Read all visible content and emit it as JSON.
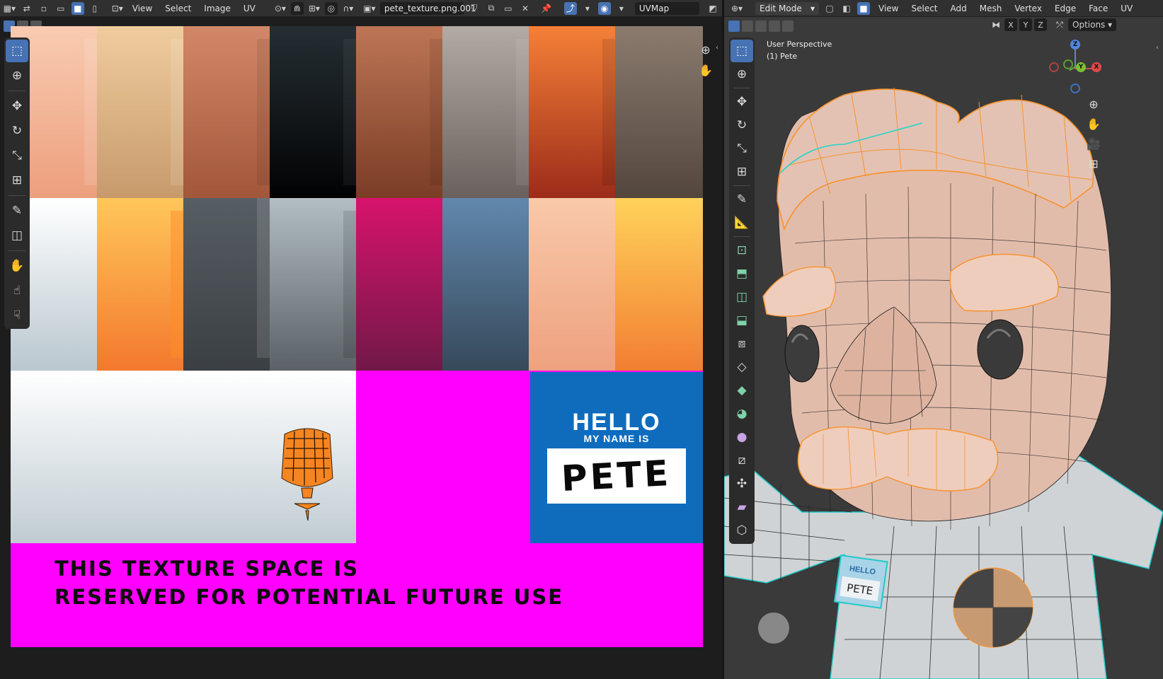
{
  "uv_editor": {
    "menus": [
      "View",
      "Select",
      "Image",
      "UV"
    ],
    "image_name": "pete_texture.png.001",
    "uv_map": "UVMap",
    "texture": {
      "hello_card": {
        "title": "HELLO",
        "subtitle": "MY NAME IS",
        "name": "PETE"
      },
      "reserved_line1": "THIS TEXTURE SPACE IS",
      "reserved_line2": "RESERVED FOR POTENTIAL FUTURE USE"
    }
  },
  "viewport": {
    "mode": "Edit Mode",
    "menus": [
      "View",
      "Select",
      "Add",
      "Mesh",
      "Vertex",
      "Edge",
      "Face",
      "UV"
    ],
    "perspective": "User Perspective",
    "object": "(1) Pete",
    "axes": [
      "X",
      "Y",
      "Z"
    ],
    "options_label": "Options",
    "gizmo": {
      "x": "X",
      "y": "Y",
      "z": "Z"
    },
    "badge_hello": "HELLO",
    "badge_name": "PETE"
  },
  "icons": {
    "uv_tools": [
      "select-box-icon",
      "cursor-icon",
      "move-icon",
      "rotate-icon",
      "scale-icon",
      "transform-icon",
      "annotate-icon",
      "rip-icon",
      "grab-icon",
      "relax-icon",
      "pinch-icon"
    ],
    "vp_tools": [
      "select-box-icon",
      "cursor-icon",
      "move-icon",
      "rotate-icon",
      "scale-icon",
      "transform-icon",
      "annotate-icon",
      "measure-icon",
      "add-cube-icon",
      "extrude-icon",
      "inset-icon",
      "bevel-icon",
      "loop-cut-icon",
      "knife-icon",
      "poly-build-icon",
      "spin-icon",
      "smooth-icon",
      "edge-slide-icon",
      "shrink-fatten-icon",
      "shear-icon",
      "rip-region-icon"
    ]
  },
  "colors": {
    "accent": "#4772b3",
    "magenta": "#ff00ff",
    "card_blue": "#0f6cbd"
  }
}
